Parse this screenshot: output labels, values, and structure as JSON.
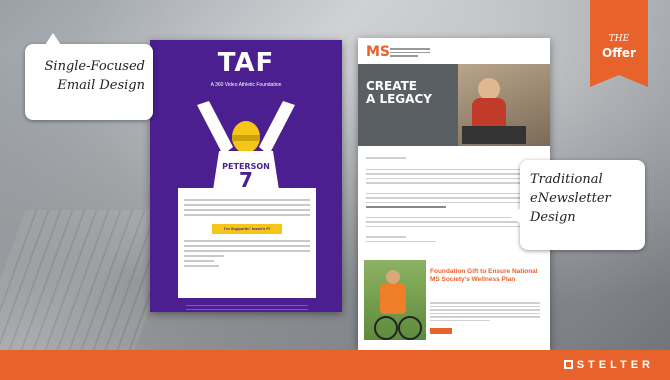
{
  "slide": {
    "offer_tag": {
      "pre": "THE",
      "main": "Offer"
    },
    "callout_left": {
      "line1": "Single-Focused",
      "line2": "Email Design"
    },
    "callout_right": {
      "line1": "Traditional",
      "line2": "eNewsletter",
      "line3": "Design"
    },
    "brand": "STELTER"
  },
  "email1": {
    "logo": "TAF",
    "subtitle": "A 360 Video Athletic Foundation",
    "cta_label": "I'm Supportin' Issan's Fi"
  },
  "email2": {
    "logo": "MS",
    "hero_title_line1": "CREATE",
    "hero_title_line2": "A LEGACY",
    "feature_title": "Foundation Gift to Ensure National MS Society's Wellness Plan"
  },
  "colors": {
    "accent_orange": "#e8622c",
    "taf_purple": "#4b1f8f",
    "taf_gold": "#f5c518"
  }
}
